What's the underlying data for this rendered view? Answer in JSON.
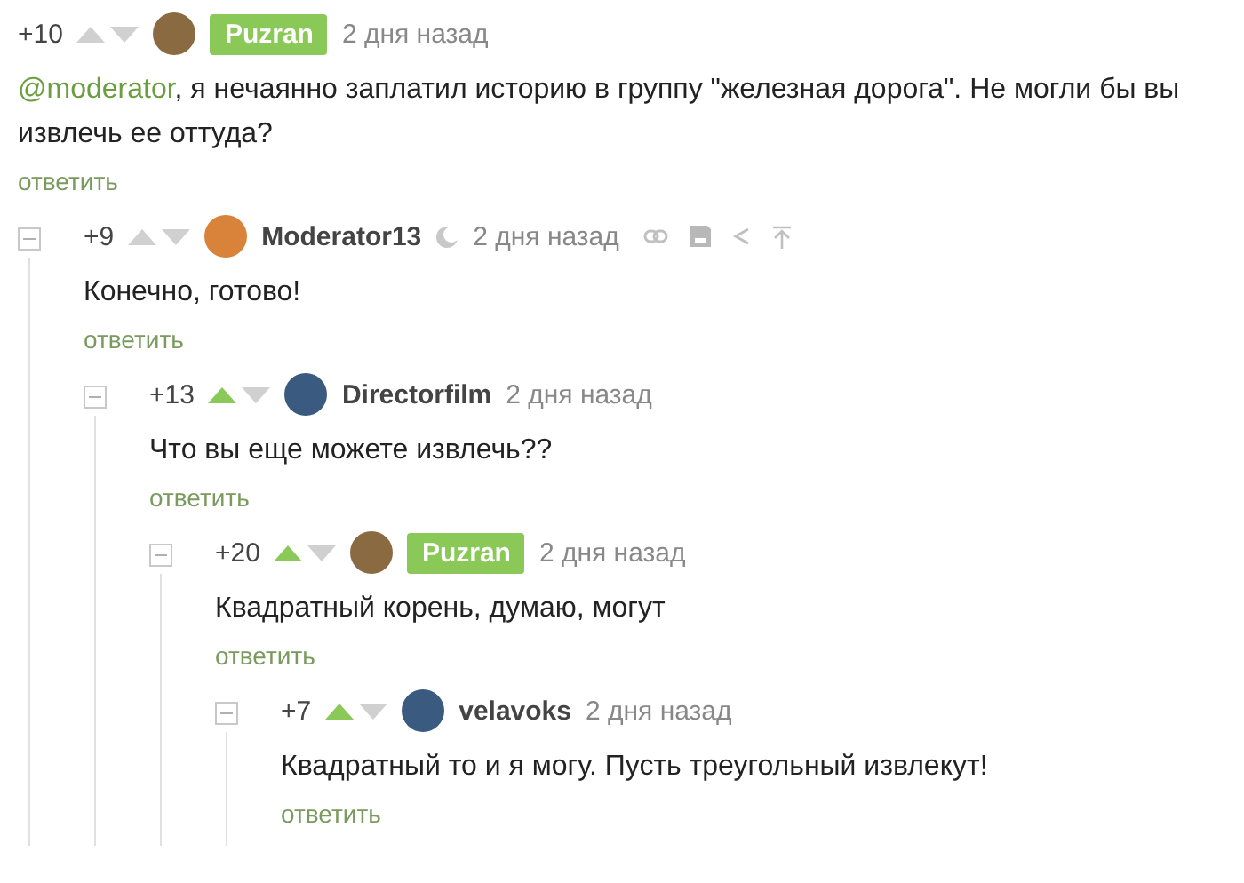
{
  "comment": {
    "rating": "+10",
    "upvoted": false,
    "author": "Puzran",
    "author_is_op": true,
    "moderator": false,
    "time": "2 дня назад",
    "actions": false,
    "mention": "@moderator",
    "text": ", я нечаянно заплатил историю в группу \"железная дорога\". Не могли бы вы извлечь ее оттуда?",
    "reply": "ответить",
    "collapsible": false,
    "children": [
      {
        "rating": "+9",
        "upvoted": false,
        "author": "Moderator13",
        "author_is_op": false,
        "moderator": true,
        "time": "2 дня назад",
        "actions": true,
        "text": "Конечно, готово!",
        "reply": "ответить",
        "collapsible": true,
        "children": [
          {
            "rating": "+13",
            "upvoted": true,
            "author": "Directorfilm",
            "author_is_op": false,
            "moderator": false,
            "time": "2 дня назад",
            "actions": false,
            "text": "Что вы еще можете извлечь??",
            "reply": "ответить",
            "collapsible": true,
            "children": [
              {
                "rating": "+20",
                "upvoted": true,
                "author": "Puzran",
                "author_is_op": true,
                "moderator": false,
                "time": "2 дня назад",
                "actions": false,
                "text": "Квадратный корень, думаю, могут",
                "reply": "ответить",
                "collapsible": true,
                "children": [
                  {
                    "rating": "+7",
                    "upvoted": true,
                    "author": "velavoks",
                    "author_is_op": false,
                    "moderator": false,
                    "time": "2 дня назад",
                    "actions": false,
                    "text": "Квадратный то и я могу. Пусть треугольный извлекут!",
                    "reply": "ответить",
                    "collapsible": true
                  }
                ]
              }
            ]
          }
        ]
      }
    ]
  }
}
